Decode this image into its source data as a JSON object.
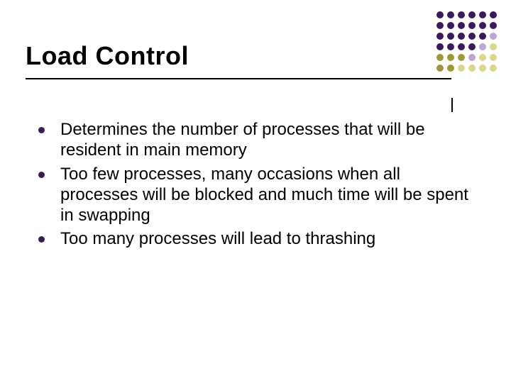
{
  "slide": {
    "title": "Load Control",
    "bullets": [
      "Determines the number of processes that will be resident in main memory",
      "Too few processes, many occasions when all processes will be blocked and much time will be spent in swapping",
      "Too many processes will lead to thrashing"
    ]
  },
  "decor": {
    "dot_colors": {
      "dark_purple": "#3a1a5a",
      "light_purple": "#b9a6d4",
      "olive": "#9a9a33",
      "light_olive": "#d8d88a"
    },
    "grid_pattern": [
      [
        "dark_purple",
        "dark_purple",
        "dark_purple",
        "dark_purple",
        "dark_purple",
        "dark_purple"
      ],
      [
        "dark_purple",
        "dark_purple",
        "dark_purple",
        "dark_purple",
        "dark_purple",
        "dark_purple"
      ],
      [
        "dark_purple",
        "dark_purple",
        "dark_purple",
        "dark_purple",
        "dark_purple",
        "light_purple"
      ],
      [
        "dark_purple",
        "dark_purple",
        "dark_purple",
        "dark_purple",
        "light_purple",
        "light_olive"
      ],
      [
        "olive",
        "olive",
        "olive",
        "light_purple",
        "light_olive",
        "light_olive"
      ],
      [
        "olive",
        "olive",
        "light_olive",
        "light_olive",
        "light_olive",
        "light_olive"
      ]
    ]
  }
}
